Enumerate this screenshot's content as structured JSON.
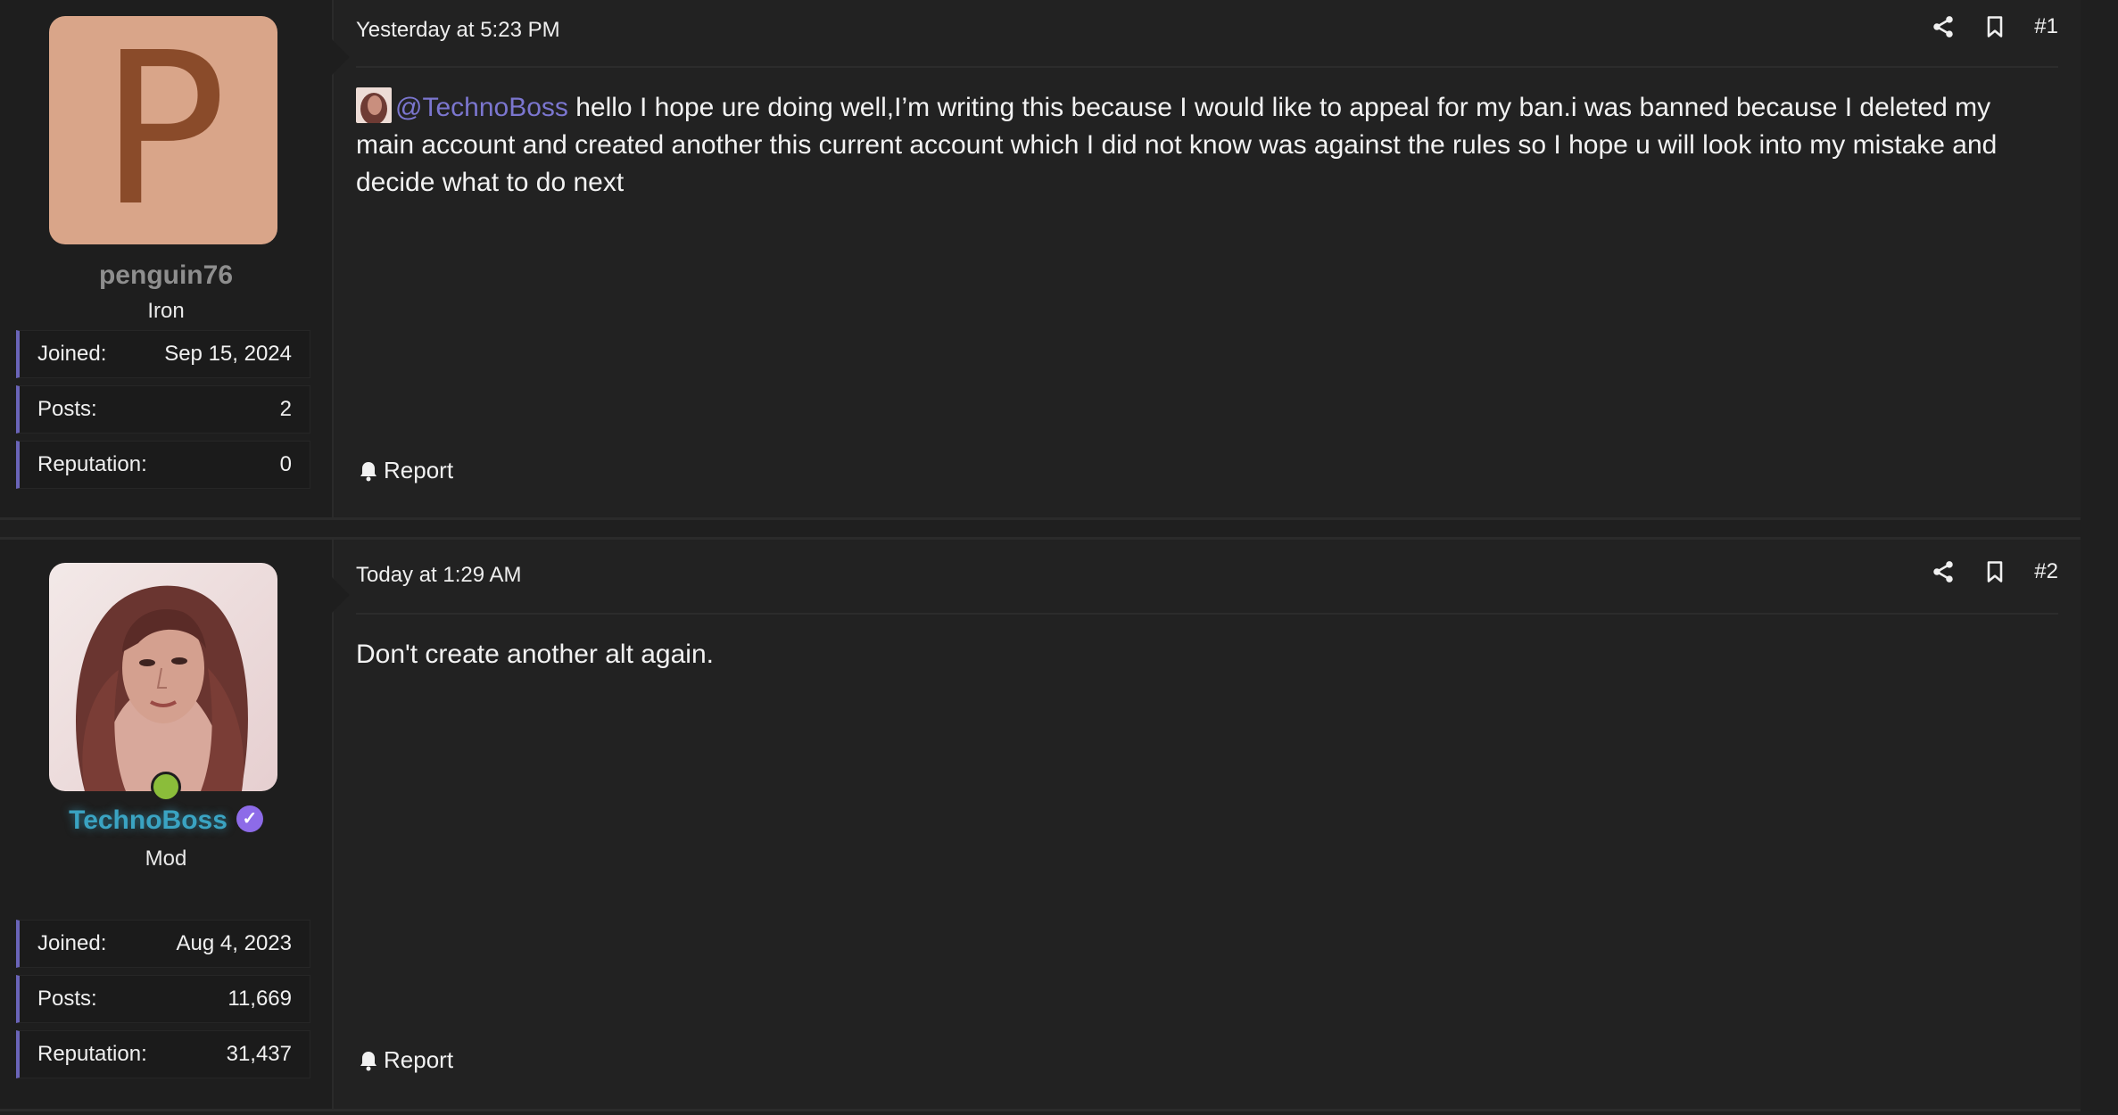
{
  "posts": [
    {
      "user": {
        "avatar_letter": "P",
        "name": "penguin76",
        "title": "Iron",
        "stats": [
          {
            "label": "Joined:",
            "value": "Sep 15, 2024"
          },
          {
            "label": "Posts:",
            "value": "2"
          },
          {
            "label": "Reputation:",
            "value": "0"
          }
        ]
      },
      "date": "Yesterday at 5:23 PM",
      "number": "#1",
      "mention": "@TechnoBoss",
      "body": " hello I hope ure doing well,I’m writing this because I would like to appeal for my ban.i was banned because I deleted my main account and created another this current account which I did not know was against the rules so I hope u will look into my mistake and decide what to do next",
      "report_label": "Report"
    },
    {
      "user": {
        "name": "TechnoBoss",
        "title": "Mod",
        "verified": "✓",
        "online": true,
        "stats": [
          {
            "label": "Joined:",
            "value": "Aug 4, 2023"
          },
          {
            "label": "Posts:",
            "value": "11,669"
          },
          {
            "label": "Reputation:",
            "value": "31,437"
          }
        ]
      },
      "date": "Today at 1:29 AM",
      "number": "#2",
      "body": "Don't create another alt again.",
      "report_label": "Report"
    }
  ],
  "icons": {
    "share": "share-icon",
    "bookmark": "bookmark-icon",
    "report": "bell-icon",
    "verified": "verified-badge-icon"
  },
  "colors": {
    "background": "#1f1f1f",
    "mention": "#7b76cf",
    "mod_name": "#3aa3c2",
    "stat_accent": "#6a64b8",
    "online": "#8bbd3a",
    "avatar_bg": "#d9a589"
  }
}
